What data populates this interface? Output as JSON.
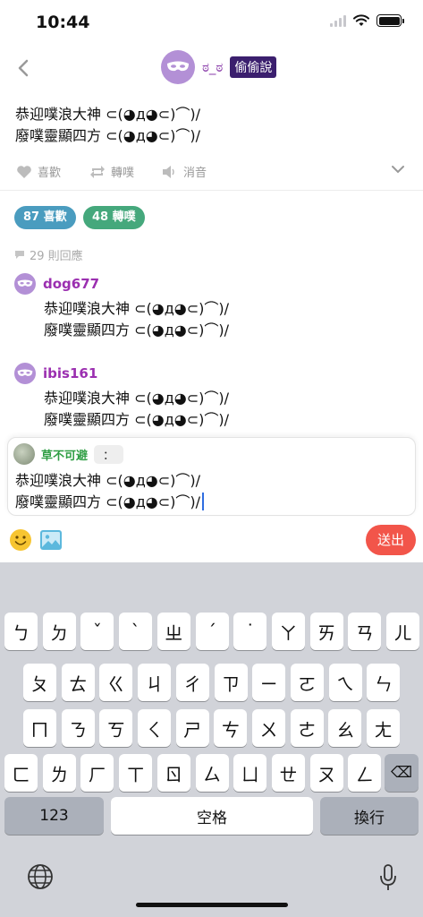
{
  "status_bar": {
    "time": "10:44"
  },
  "header": {
    "name": "ಠ_ಠ",
    "badge": "偷偷說"
  },
  "post": {
    "lines": [
      "恭迎噗浪大神 ⊂(◕д◕⊂)⌒)/",
      "廢噗靈顯四方 ⊂(◕д◕⊂)⌒)/"
    ]
  },
  "actions": {
    "like": "喜歡",
    "replurk": "轉噗",
    "mute": "消音"
  },
  "stats": {
    "likes": "87 喜歡",
    "replurks": "48 轉噗",
    "replies": "29 則回應"
  },
  "replies": [
    {
      "user": "dog677",
      "lines": [
        "恭迎噗浪大神 ⊂(◕д◕⊂)⌒)/",
        "廢噗靈顯四方 ⊂(◕д◕⊂)⌒)/"
      ]
    },
    {
      "user": "ibis161",
      "lines": [
        "恭迎噗浪大神 ⊂(◕д◕⊂)⌒)/",
        "廢噗靈顯四方 ⊂(◕д◕⊂)⌒)/"
      ]
    }
  ],
  "compose": {
    "user": "草不可避",
    "qualifier": "：",
    "lines": [
      "恭迎噗浪大神 ⊂(◕д◕⊂)⌒)/",
      "廢噗靈顯四方 ⊂(◕д◕⊂)⌒)/"
    ],
    "send": "送出"
  },
  "keyboard": {
    "rows": [
      [
        "ㄅ",
        "ㄉ",
        "ˇ",
        "ˋ",
        "ㄓ",
        "ˊ",
        "˙",
        "ㄚ",
        "ㄞ",
        "ㄢ",
        "ㄦ"
      ],
      [
        "ㄆ",
        "ㄊ",
        "ㄍ",
        "ㄐ",
        "ㄔ",
        "ㄗ",
        "ㄧ",
        "ㄛ",
        "ㄟ",
        "ㄣ"
      ],
      [
        "ㄇ",
        "ㄋ",
        "ㄎ",
        "ㄑ",
        "ㄕ",
        "ㄘ",
        "ㄨ",
        "ㄜ",
        "ㄠ",
        "ㄤ"
      ],
      [
        "ㄈ",
        "ㄌ",
        "ㄏ",
        "ㄒ",
        "ㄖ",
        "ㄙ",
        "ㄩ",
        "ㄝ",
        "ㄡ",
        "ㄥ"
      ]
    ],
    "backspace": "⌫",
    "numbers": "123",
    "space": "空格",
    "return": "換行"
  },
  "colors": {
    "accent_purple": "#8e44ad",
    "send_red": "#f2554a",
    "likes_blue": "#4a9cbf",
    "replurks_green": "#45a87c"
  }
}
